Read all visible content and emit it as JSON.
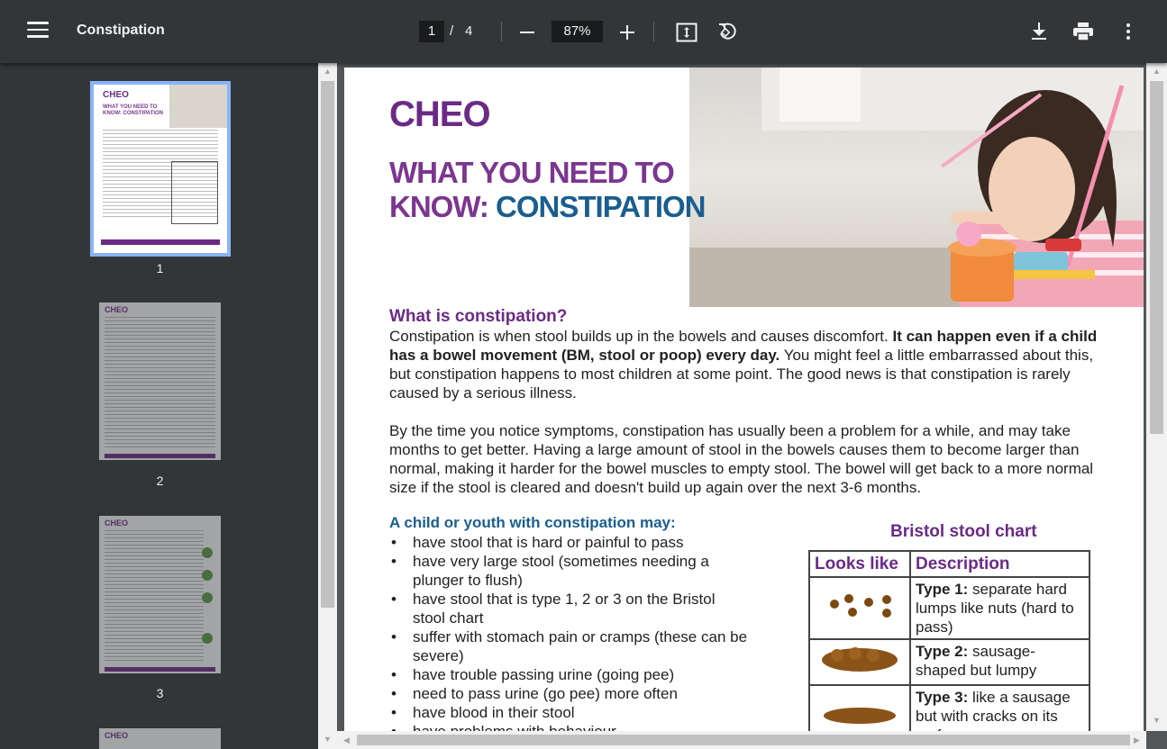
{
  "toolbar": {
    "title": "Constipation",
    "current_page": "1",
    "page_separator": "/",
    "total_pages": "4",
    "zoom": "87%",
    "icons": [
      "menu-icon",
      "zoom-out-icon",
      "zoom-in-icon",
      "fit-page-icon",
      "rotate-icon",
      "download-icon",
      "print-icon",
      "more-options-icon"
    ]
  },
  "sidebar": {
    "thumbnails": [
      {
        "label": "1",
        "selected": true,
        "logo": "CHEO",
        "heading": "WHAT YOU NEED TO KNOW: CONSTIPATION"
      },
      {
        "label": "2",
        "selected": false,
        "logo": "CHEO"
      },
      {
        "label": "3",
        "selected": false,
        "logo": "CHEO"
      },
      {
        "label": "",
        "selected": false,
        "logo": "CHEO"
      }
    ]
  },
  "document": {
    "logo": "CHEO",
    "headline_line1": "WHAT YOU NEED TO",
    "headline_line2_a": "KNOW: ",
    "headline_line2_b": "CONSTIPATION",
    "what_heading": "What is constipation?",
    "para1_a": "Constipation is when stool builds up in the bowels and causes discomfort.  ",
    "para1_bold": "It can happen even if a child has a bowel movement (BM, stool or poop) every day.",
    "para1_b": " You might feel a little embarrassed about this, but constipation happens to most children at some point. The good news is that constipation is rarely caused by a serious illness.",
    "para2": "By the time you notice symptoms, constipation has usually been a problem for a while, and may take months to get better. Having a large amount of stool in the bowels causes them to become larger than normal, making it harder for the bowel muscles to empty stool. The bowel will get back to a more normal size if the stool is cleared and doesn't build up again over the next 3-6 months.",
    "child_heading": "A child or youth with constipation may:",
    "bullets": [
      "have stool that is hard or painful to pass",
      "have very large stool (sometimes needing a plunger to flush)",
      "have stool that is type 1, 2 or 3 on the Bristol stool chart",
      "suffer with stomach pain or cramps (these can be severe)",
      "have trouble passing urine (going pee)",
      "need to pass urine (go pee) more often",
      "have blood in their stool",
      "have problems with behaviour"
    ],
    "bristol": {
      "title": "Bristol stool chart",
      "col_looks": "Looks like",
      "col_desc": "Description",
      "rows": [
        {
          "type": "Type 1:",
          "desc": " separate hard lumps like nuts (hard to pass)"
        },
        {
          "type": "Type 2:",
          "desc": " sausage-shaped but lumpy"
        },
        {
          "type": "Type 3:",
          "desc": " like a sausage but with cracks on its surface"
        }
      ]
    }
  },
  "colors": {
    "toolbar_bg": "#323639",
    "viewer_bg": "#525659",
    "brand_purple": "#7b3690",
    "brand_blue": "#1a5e8f",
    "selection": "#8ab4f8"
  }
}
